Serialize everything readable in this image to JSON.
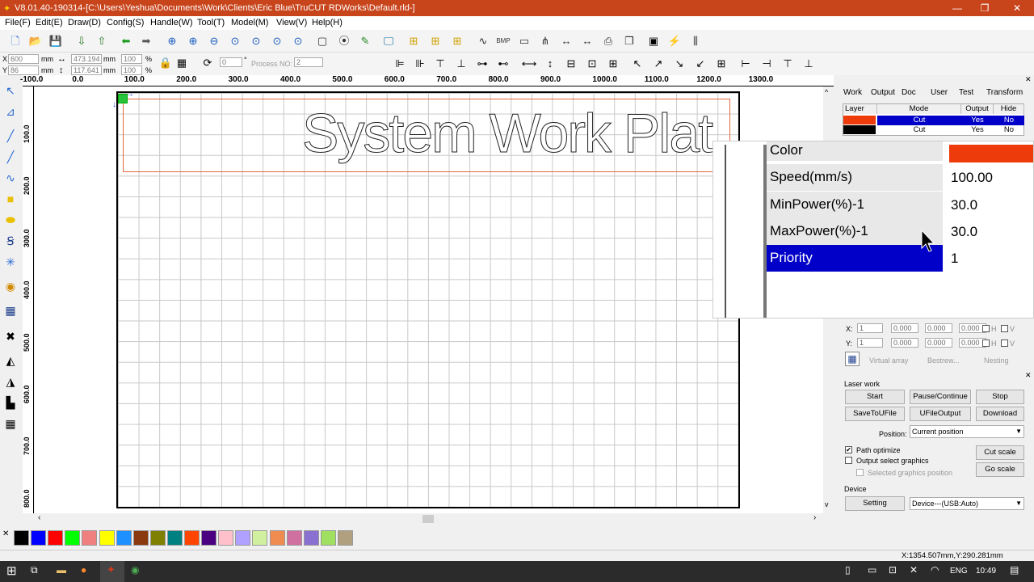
{
  "window": {
    "title": "V8.01.40-190314-[C:\\Users\\Yeshua\\Documents\\Work\\Clients\\Eric Blue\\TruCUT RDWorks\\Default.rld-]",
    "minimize": "—",
    "maximize": "❐",
    "close": "✕"
  },
  "menu": [
    "File(F)",
    "Edit(E)",
    "Draw(D)",
    "Config(S)",
    "Handle(W)",
    "Tool(T)",
    "Model(M)",
    "View(V)",
    "Help(H)"
  ],
  "coords": {
    "x_label": "X",
    "x_value": "600",
    "x_unit": "mm",
    "y_label": "Y",
    "y_value": "86",
    "y_unit": "mm",
    "w_value": "473.194",
    "w_unit": "mm",
    "h_value": "117.641",
    "h_unit": "mm",
    "pct1": "100",
    "pct1_unit": "%",
    "pct2": "100",
    "pct2_unit": "%",
    "rotate": "0",
    "rotate_unit": "°",
    "process_label": "Process NO:",
    "process_value": "2"
  },
  "ruler_top": [
    "-100.0",
    "0.0",
    "100.0",
    "200.0",
    "300.0",
    "400.0",
    "500.0",
    "600.0",
    "700.0",
    "800.0",
    "900.0",
    "1000.0",
    "1100.0",
    "1200.0",
    "1300.0"
  ],
  "ruler_left": [
    "100.0",
    "200.0",
    "300.0",
    "400.0",
    "500.0",
    "600.0",
    "700.0",
    "800.0"
  ],
  "canvas_text": "System Work Plat",
  "palette": [
    "#000000",
    "#0000ff",
    "#ff0000",
    "#00ff00",
    "#f08080",
    "#ffff00",
    "#1e90ff",
    "#8b3a0f",
    "#808000",
    "#008080",
    "#ff4500",
    "#4b0082",
    "#ffc0cb",
    "#b0a0ff",
    "#d0f0a0",
    "#f08c50",
    "#d070a0",
    "#8a70d0",
    "#a0e060",
    "#b0a080"
  ],
  "status": "X:1354.507mm,Y:290.281mm",
  "tabs": [
    "Work",
    "Output",
    "Doc",
    "User",
    "Test",
    "Transform"
  ],
  "layer_table": {
    "headers": [
      "Layer",
      "Mode",
      "Output",
      "Hide"
    ],
    "rows": [
      {
        "color": "#ee3b0b",
        "mode": "Cut",
        "output": "Yes",
        "hide": "No"
      },
      {
        "color": "#000000",
        "mode": "Cut",
        "output": "Yes",
        "hide": "No"
      }
    ]
  },
  "properties": [
    {
      "name": "Color",
      "value": ""
    },
    {
      "name": "Speed(mm/s)",
      "value": "100.00"
    },
    {
      "name": "MinPower(%)-1",
      "value": "30.0"
    },
    {
      "name": "MaxPower(%)-1",
      "value": "30.0"
    },
    {
      "name": "Priority",
      "value": "1"
    }
  ],
  "property_color": "#ee3b0b",
  "array": {
    "x_label": "X:",
    "y_label": "Y:",
    "x_vals": [
      "1",
      "0.000",
      "0.000",
      "0.000"
    ],
    "y_vals": [
      "1",
      "0.000",
      "0.000",
      "0.000"
    ],
    "h": "H",
    "v": "V",
    "virtual_array": "Virtual array",
    "bestrew": "Bestrew...",
    "nesting": "Nesting"
  },
  "laser_work": {
    "title": "Laser work",
    "start": "Start",
    "pause": "Pause/Continue",
    "stop": "Stop",
    "save_to_ufile": "SaveToUFile",
    "ufile_output": "UFileOutput",
    "download": "Download",
    "position_label": "Position:",
    "position_value": "Current position",
    "path_optimize": "Path optimize",
    "output_select": "Output select graphics",
    "selected_position": "Selected graphics position",
    "cut_scale": "Cut scale",
    "go_scale": "Go scale",
    "device_title": "Device",
    "setting": "Setting",
    "device_value": "Device---(USB:Auto)"
  },
  "taskbar": {
    "lang": "ENG",
    "time": "10:49"
  }
}
